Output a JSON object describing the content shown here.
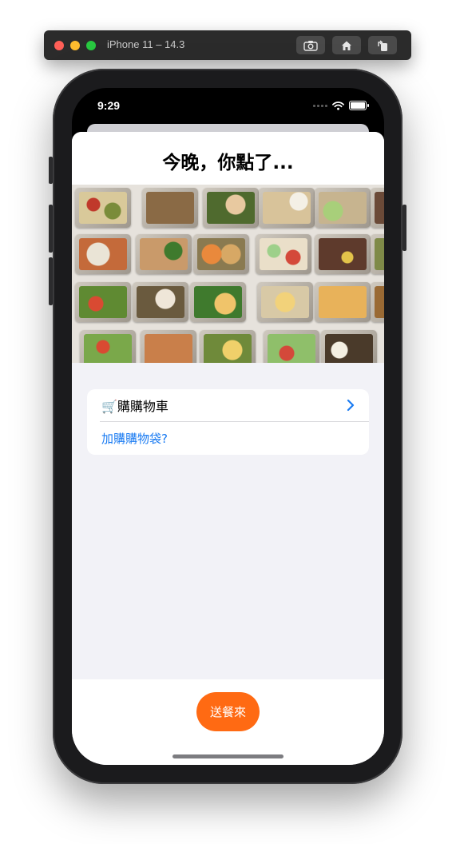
{
  "simulator": {
    "device_title": "iPhone 11 – 14.3",
    "toolbar_icons": [
      "screenshot-icon",
      "home-icon",
      "rotate-icon"
    ]
  },
  "status_bar": {
    "time": "9:29",
    "icons": [
      "signal-icon",
      "wifi-icon",
      "battery-icon"
    ]
  },
  "sheet": {
    "title": "今晚，你點了..."
  },
  "hero_image": {
    "subject": "grid of meal prep trays"
  },
  "cart_card": {
    "cart_label": "🛒購購物車",
    "add_bag_label": "加購購物袋?"
  },
  "action": {
    "deliver_label": "送餐來"
  },
  "colors": {
    "accent_orange": "#ff6a13",
    "link_blue": "#1a7bf2",
    "background_grouped": "#f2f2f7"
  }
}
